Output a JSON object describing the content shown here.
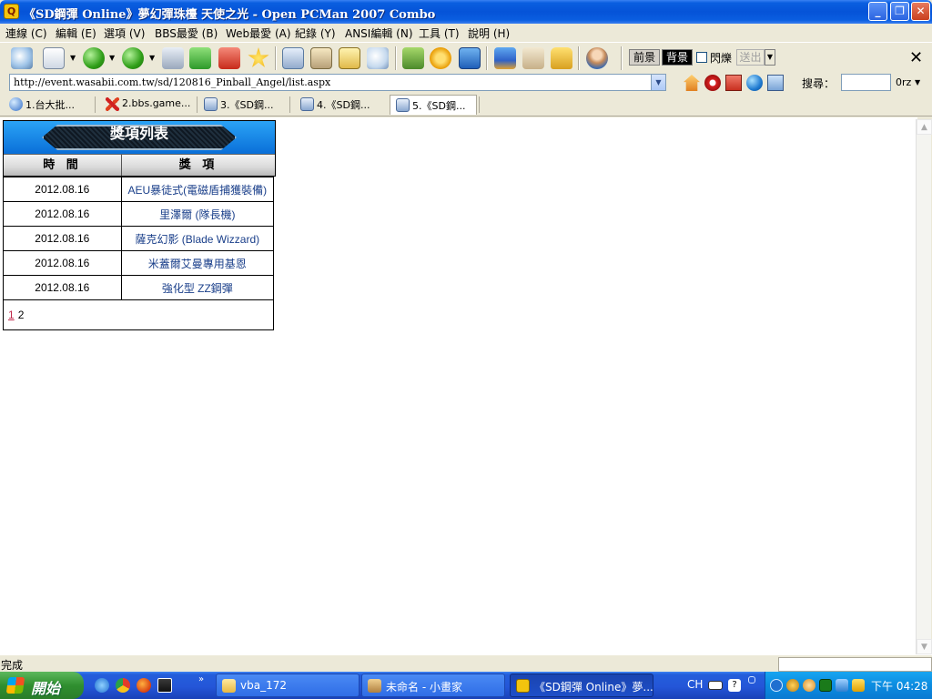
{
  "window": {
    "title": "《SD鋼彈 Online》夢幻彈珠檯 天使之光 - Open PCMan 2007 Combo"
  },
  "menu": [
    "連線 (C)",
    "編輯 (E)",
    "選項 (V)",
    "BBS最愛 (B)",
    "Web最愛 (A)",
    "紀錄 (Y)",
    "ANSI編輯 (N)",
    "工具 (T)",
    "說明 (H)"
  ],
  "toolbar": {
    "foreground_label": "前景",
    "background_label": "背景",
    "blink_label": "閃爍",
    "send_label": "送出"
  },
  "address": {
    "url": "http://event.wasabii.com.tw/sd/120816_Pinball_Angel/list.aspx",
    "search_label": "搜尋：",
    "search_engine": "0rz"
  },
  "tabs": [
    "1.台大批...",
    "2.bbs.game...",
    "3.《SD鋼...",
    "4.《SD鋼...",
    "5.《SD鋼..."
  ],
  "page": {
    "panel_title": "獎項列表",
    "col_time": "時 間",
    "col_award": "獎 項",
    "rows": [
      {
        "date": "2012.08.16",
        "award": "AEU暴徒式(電磁盾捕獲裝備)"
      },
      {
        "date": "2012.08.16",
        "award": "里澤爾 (隊長機)"
      },
      {
        "date": "2012.08.16",
        "award": "薩克幻影 (Blade Wizzard)"
      },
      {
        "date": "2012.08.16",
        "award": "米蓋爾艾曼專用基恩"
      },
      {
        "date": "2012.08.16",
        "award": "強化型 ZZ鋼彈"
      }
    ],
    "pages": [
      "1",
      "2"
    ]
  },
  "status": {
    "text": "完成"
  },
  "taskbar": {
    "start_label": "開始",
    "tasks": [
      "vba_172",
      "未命名 - 小畫家",
      "《SD鋼彈 Online》夢..."
    ],
    "language": "CH",
    "clock": "下午 04:28"
  }
}
